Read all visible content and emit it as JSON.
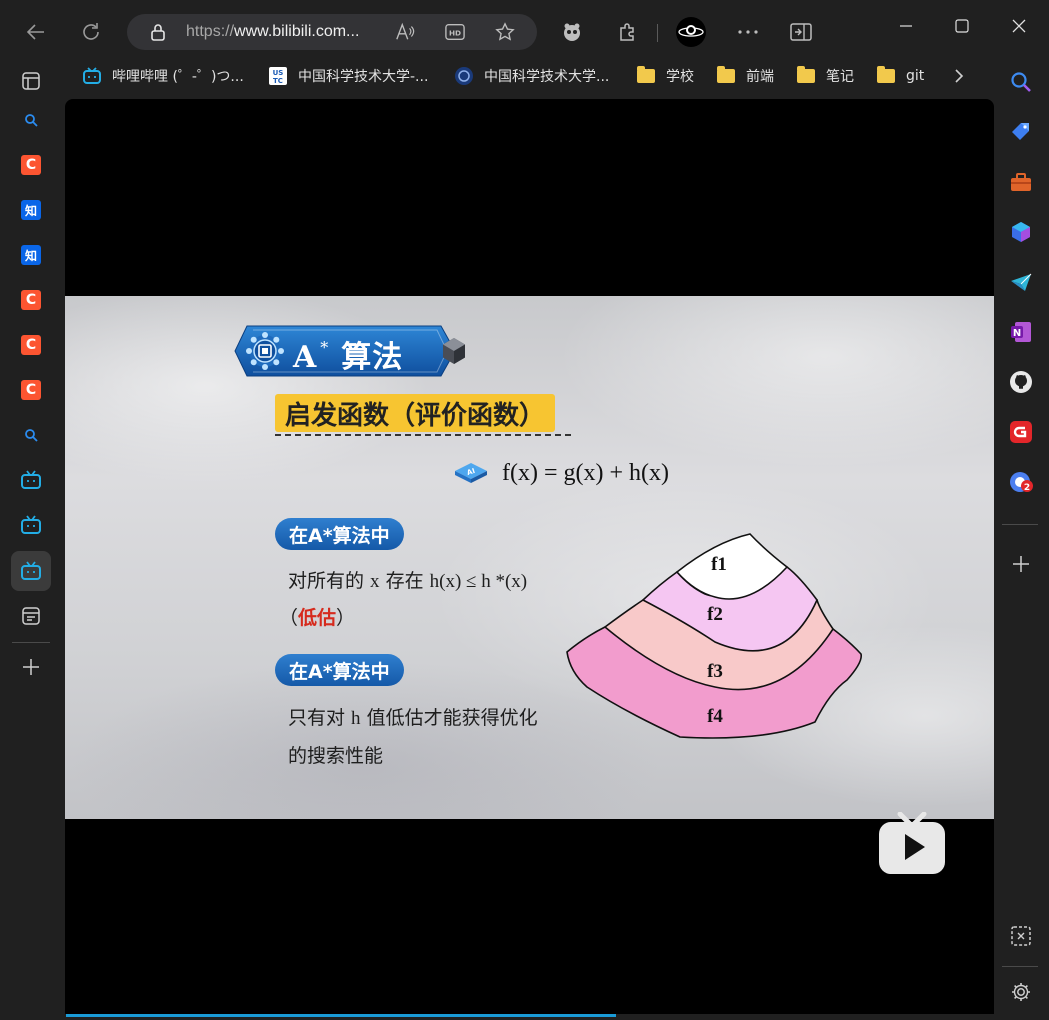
{
  "browser": {
    "url_scheme": "https://",
    "url_host": "www.bilibili.com...",
    "bookmarks": [
      {
        "label": "哔哩哔哩 (゜-゜)つ...",
        "icon": "bilibili-icon"
      },
      {
        "label": "中国科学技术大学-...",
        "icon": "ustc-icon"
      },
      {
        "label": "中国科学技术大学...",
        "icon": "ustc-seal-icon"
      },
      {
        "label": "学校",
        "icon": "folder-icon"
      },
      {
        "label": "前端",
        "icon": "folder-icon"
      },
      {
        "label": "笔记",
        "icon": "folder-icon"
      },
      {
        "label": "git",
        "icon": "folder-icon"
      }
    ],
    "tabs": [
      {
        "icon": "search-icon"
      },
      {
        "icon": "csdn-icon",
        "glyph": "C"
      },
      {
        "icon": "zhihu-icon",
        "glyph": "知"
      },
      {
        "icon": "zhihu-icon",
        "glyph": "知"
      },
      {
        "icon": "csdn-icon",
        "glyph": "C"
      },
      {
        "icon": "csdn-icon",
        "glyph": "C"
      },
      {
        "icon": "csdn-icon",
        "glyph": "C"
      },
      {
        "icon": "search-icon"
      },
      {
        "icon": "bilibili-icon"
      },
      {
        "icon": "bilibili-icon"
      },
      {
        "icon": "bilibili-icon",
        "active": true
      },
      {
        "icon": "collections-icon"
      }
    ],
    "right_sidebar_badge": "2"
  },
  "slide": {
    "title_main": "A",
    "title_sup": "*",
    "title_suffix": "算法",
    "heading": "启发函数（评价函数）",
    "formula": "f(x) = g(x) + h(x)",
    "pill_1": "在A*算法中",
    "line_1_a": "对所有的 ",
    "line_1_math": "x",
    "line_1_b": " 存在 ",
    "line_1_math2": "h(x) ≤ h *(x)",
    "line_2_open": "（",
    "line_2_hl": "低估",
    "line_2_close": "）",
    "pill_2": "在A*算法中",
    "line_3_a": "只有对 ",
    "line_3_math": "h",
    "line_3_b": " 值低估才能获得优化",
    "line_4": "的搜索性能",
    "diagram_labels": [
      "f1",
      "f2",
      "f3",
      "f4"
    ]
  },
  "colors": {
    "accent_blue": "#1559a8",
    "heading_yellow": "#f7c531",
    "highlight_red": "#d62a1d",
    "layer_f1": "#ffffff",
    "layer_f2": "#f5c6f2",
    "layer_f3": "#f8c9c9",
    "layer_f4": "#f29ccd"
  }
}
